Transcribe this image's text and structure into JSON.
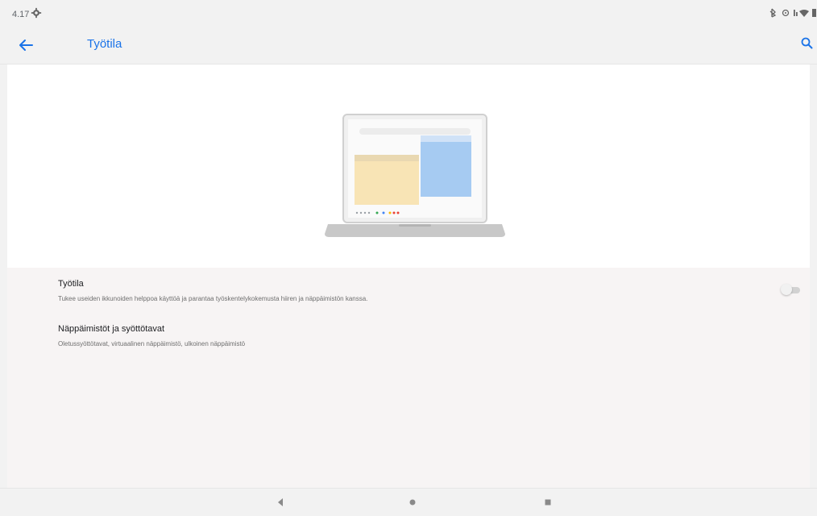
{
  "status_bar": {
    "time": "4.17"
  },
  "app_bar": {
    "title": "Työtila",
    "accent_color": "#1a73e8"
  },
  "illustration": {
    "description_icon": "laptop-desktop-mode-illustration"
  },
  "settings": {
    "items": [
      {
        "title": "Työtila",
        "summary": "Tukee useiden ikkunoiden helppoa käyttöä ja parantaa työskentelykokemusta hiiren ja näppäimistön kanssa.",
        "toggle_on": false
      },
      {
        "title": "Näppäimistöt ja syöttötavat",
        "summary": "Oletussyöttötavat, virtuaalinen näppäimistö, ulkoinen näppäimistö"
      }
    ]
  },
  "nav_bar": {
    "back_icon": "triangle-back-icon",
    "home_icon": "circle-home-icon",
    "recents_icon": "square-recents-icon"
  }
}
